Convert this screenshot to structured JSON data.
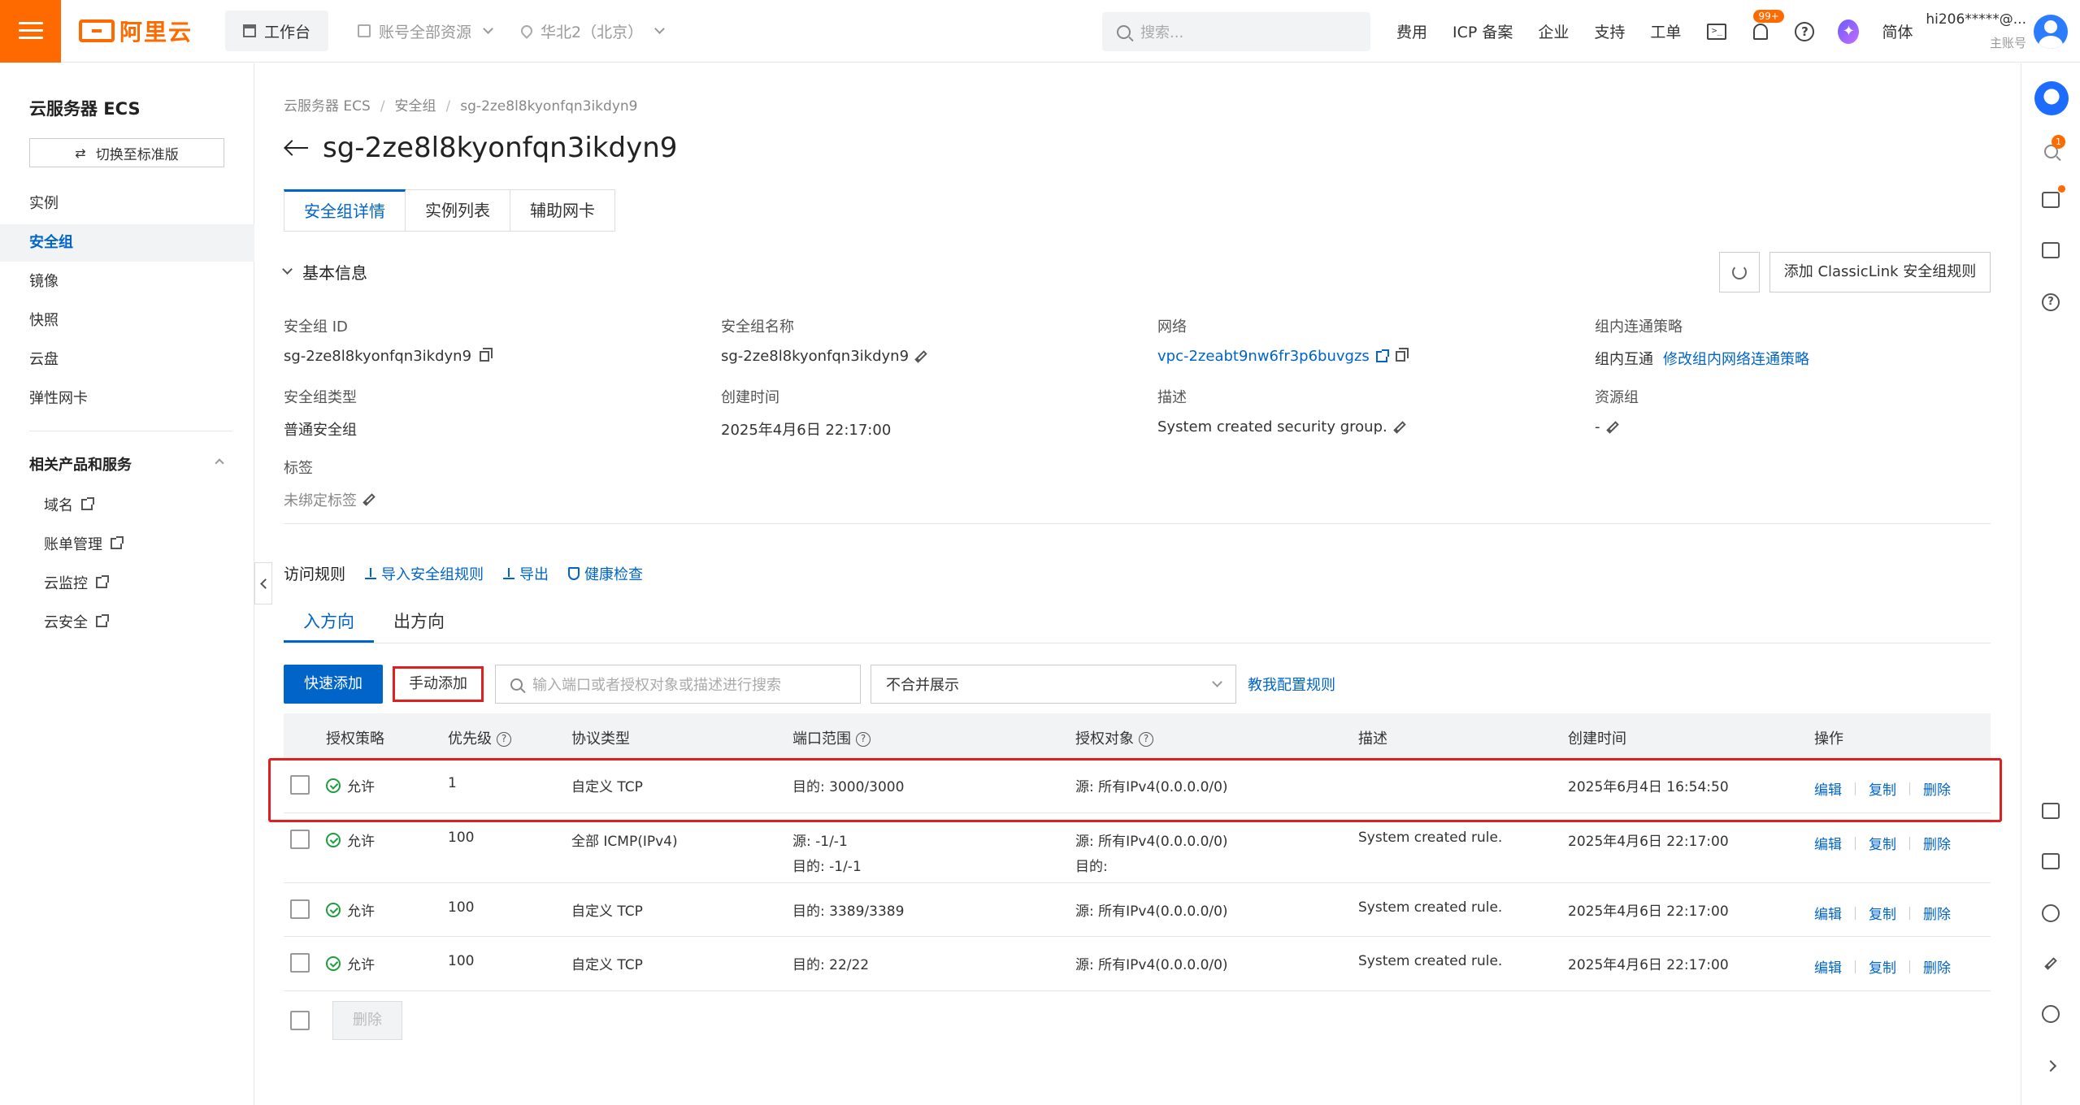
{
  "header": {
    "logo_text": "阿里云",
    "workbench": "工作台",
    "account_scope": "账号全部资源",
    "region": "华北2（北京）",
    "search_placeholder": "搜索...",
    "links": [
      "费用",
      "ICP 备案",
      "企业",
      "支持",
      "工单"
    ],
    "terminal_icon_text": ">_",
    "notification_badge": "99+",
    "help_icon_text": "?",
    "ai_icon_text": "✦",
    "language": "简体",
    "user_name": "hi206*****@...",
    "user_role": "主账号"
  },
  "sidebar": {
    "title": "云服务器 ECS",
    "switch_label": "切换至标准版",
    "switch_icon_text": "⇄",
    "items": [
      {
        "label": "实例"
      },
      {
        "label": "安全组"
      },
      {
        "label": "镜像"
      },
      {
        "label": "快照"
      },
      {
        "label": "云盘"
      },
      {
        "label": "弹性网卡"
      }
    ],
    "section_title": "相关产品和服务",
    "sub_items": [
      {
        "label": "域名"
      },
      {
        "label": "账单管理"
      },
      {
        "label": "云监控"
      },
      {
        "label": "云安全"
      }
    ]
  },
  "rail": {
    "dot_badge": "1",
    "help_icon_text": "?"
  },
  "breadcrumb": [
    "云服务器 ECS",
    "安全组",
    "sg-2ze8l8kyonfqn3ikdyn9"
  ],
  "page_title": "sg-2ze8l8kyonfqn3ikdyn9",
  "tabs": [
    "安全组详情",
    "实例列表",
    "辅助网卡"
  ],
  "basic_info": {
    "title": "基本信息",
    "add_classiclink_button": "添加 ClassicLink 安全组规则",
    "fields": {
      "sg_id": {
        "label": "安全组 ID",
        "value": "sg-2ze8l8kyonfqn3ikdyn9"
      },
      "sg_name": {
        "label": "安全组名称",
        "value": "sg-2ze8l8kyonfqn3ikdyn9"
      },
      "network": {
        "label": "网络",
        "value": "vpc-2zeabt9nw6fr3p6buvgzs"
      },
      "intra_policy": {
        "label": "组内连通策略",
        "value": "组内互通",
        "link": "修改组内网络连通策略"
      },
      "sg_type": {
        "label": "安全组类型",
        "value": "普通安全组"
      },
      "created": {
        "label": "创建时间",
        "value": "2025年4月6日 22:17:00"
      },
      "description": {
        "label": "描述",
        "value": "System created security group."
      },
      "resource_group": {
        "label": "资源组",
        "value": "-"
      },
      "tags": {
        "label": "标签",
        "value": "未绑定标签"
      }
    }
  },
  "access_rules": {
    "title": "访问规则",
    "actions": [
      "导入安全组规则",
      "导出",
      "健康检查"
    ],
    "direction_tabs": [
      "入方向",
      "出方向"
    ],
    "quick_add": "快速添加",
    "manual_add": "手动添加",
    "search_placeholder": "输入端口或者授权对象或描述进行搜索",
    "merge_select": "不合并展示",
    "teach_link": "教我配置规则",
    "columns": [
      "授权策略",
      "优先级",
      "协议类型",
      "端口范围",
      "授权对象",
      "描述",
      "创建时间",
      "操作"
    ],
    "question_mark": "?",
    "rows": [
      {
        "policy": "允许",
        "priority": "1",
        "protocol": "自定义 TCP",
        "port": "目的: 3000/3000",
        "port2": "",
        "object": "源: 所有IPv4(0.0.0.0/0)",
        "object2": "",
        "desc": "",
        "time": "2025年6月4日 16:54:50"
      },
      {
        "policy": "允许",
        "priority": "100",
        "protocol": "全部 ICMP(IPv4)",
        "port": "源: -1/-1",
        "port2": "目的: -1/-1",
        "object": "源: 所有IPv4(0.0.0.0/0)",
        "object2": "目的:",
        "desc": "System created rule.",
        "time": "2025年4月6日 22:17:00"
      },
      {
        "policy": "允许",
        "priority": "100",
        "protocol": "自定义 TCP",
        "port": "目的: 3389/3389",
        "port2": "",
        "object": "源: 所有IPv4(0.0.0.0/0)",
        "object2": "",
        "desc": "System created rule.",
        "time": "2025年4月6日 22:17:00"
      },
      {
        "policy": "允许",
        "priority": "100",
        "protocol": "自定义 TCP",
        "port": "目的: 22/22",
        "port2": "",
        "object": "源: 所有IPv4(0.0.0.0/0)",
        "object2": "",
        "desc": "System created rule.",
        "time": "2025年4月6日 22:17:00"
      }
    ],
    "row_ops": [
      "编辑",
      "复制",
      "删除"
    ],
    "bulk_delete": "删除"
  }
}
